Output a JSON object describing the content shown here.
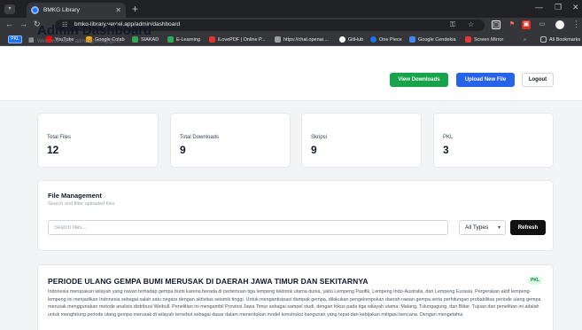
{
  "browser": {
    "tab_title": "BMKG Library",
    "url": "bmkg-library.vercel.app/admin/dashboard",
    "pkl_label": "PKL",
    "bookmarks": [
      {
        "label": "YouTube",
        "color": "#ff0000"
      },
      {
        "label": "Google Colab",
        "color": "#f9ab00"
      },
      {
        "label": "SIAKAD",
        "color": "#34a853"
      },
      {
        "label": "E-Learning",
        "color": "#34a853"
      },
      {
        "label": "iLovePDF | Online P...",
        "color": "#e5322d"
      },
      {
        "label": "https://chat.openai....",
        "color": "#9aa0a6"
      },
      {
        "label": "GitHub",
        "color": "#ffffff"
      },
      {
        "label": "One Piece",
        "color": "#1a73e8"
      },
      {
        "label": "Google Cendekia",
        "color": "#4285f4"
      },
      {
        "label": "Screen Mirror",
        "color": "#e53935"
      }
    ],
    "all_bookmarks": "All Bookmarks"
  },
  "header": {
    "title": "Admin Dashboard",
    "welcome": "Welcome back, admin@bmkg.go.id",
    "view_downloads": "View Downloads",
    "upload_new_file": "Upload New File",
    "logout": "Logout"
  },
  "stats": [
    {
      "label": "Total Files",
      "value": "12"
    },
    {
      "label": "Total Downloads",
      "value": "9"
    },
    {
      "label": "Skripsi",
      "value": "9"
    },
    {
      "label": "PKL",
      "value": "3"
    }
  ],
  "file_management": {
    "title": "File Management",
    "subtitle": "Search and filter uploaded files",
    "search_placeholder": "Search files...",
    "filter_value": "All Types",
    "refresh": "Refresh"
  },
  "files": [
    {
      "title": "PERIODE ULANG GEMPA BUMI MERUSAK DI DAERAH JAWA TIMUR DAN SEKITARNYA",
      "badge": "PKL",
      "description": "Indonesia merupakan wilayah yang rawan terhadap gempa bumi karena berada di pertemuan tiga lempeng tektonik utama dunia, yaitu Lempeng Pasifik, Lempeng Indo-Australia, dan Lempeng Eurasia. Pergerakan aktif lempeng-lempeng ini menjadikan Indonesia sebagai salah satu negara dengan aktivitas seismik tinggi. Untuk mengantisipasi dampak gempa, dilakukan pengelompokan daerah rawan gempa serta perhitungan probabilitas periode ulang gempa merusak menggunakan metode analisis distribusi Weibull. Penelitian ini mengambil Provinsi Jawa Timur sebagai sampel studi, dengan fokus pada tiga wilayah utama: Malang, Tulungagung, dan Blitar. Tujuan dari penelitian ini adalah untuk menghitung periode ulang gempa merusak di wilayah tersebut sebagai dasar dalam menentukan model konstruksi bangunan yang tepat dan kebijakan mitigasi bencana. Dengan mengetahui"
    }
  ]
}
